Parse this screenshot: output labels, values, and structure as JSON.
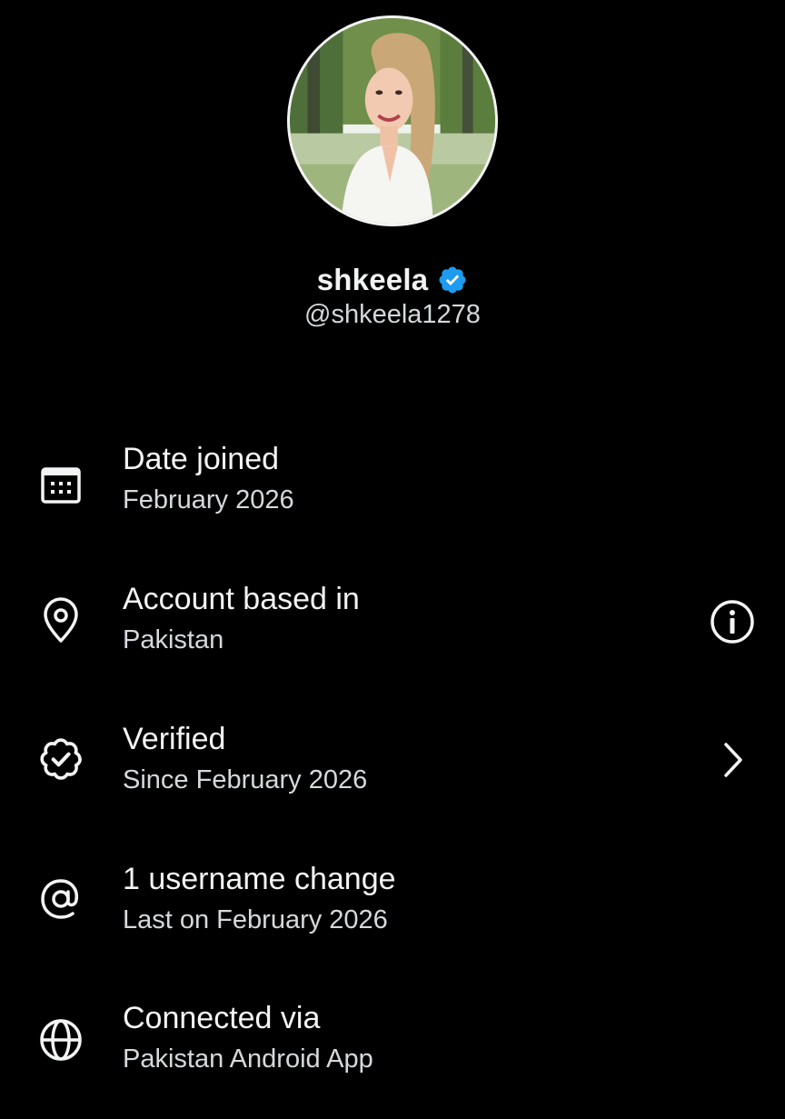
{
  "profile": {
    "display_name": "shkeela",
    "handle": "@shkeela1278",
    "verified_color": "#1d9bf0"
  },
  "about_items": [
    {
      "icon": "calendar-icon",
      "title": "Date joined",
      "subtitle": "February 2026"
    },
    {
      "icon": "location-pin-icon",
      "title": "Account based in",
      "subtitle": "Pakistan",
      "action_icon": "info-icon"
    },
    {
      "icon": "verified-badge-outline-icon",
      "title": "Verified",
      "subtitle": "Since February 2026",
      "action_icon": "chevron-right-icon"
    },
    {
      "icon": "at-sign-icon",
      "title": "1 username change",
      "subtitle": "Last on February 2026"
    },
    {
      "icon": "globe-icon",
      "title": "Connected via",
      "subtitle": "Pakistan Android App"
    }
  ],
  "colors": {
    "background": "#000000",
    "text_primary": "#f3f4f5",
    "text_secondary": "#d6d9dc",
    "accent": "#1d9bf0"
  }
}
